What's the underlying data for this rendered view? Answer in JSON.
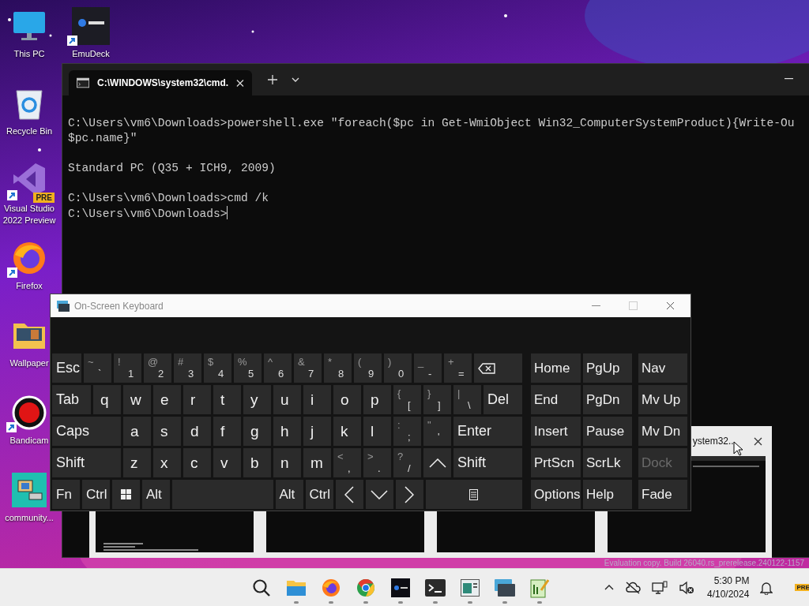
{
  "desktop_icons": [
    {
      "label": "This PC",
      "kind": "computer"
    },
    {
      "label": "EmuDeck",
      "kind": "emudeck",
      "shortcut": true
    },
    {
      "label": "Recycle Bin",
      "kind": "recycle-bin"
    },
    {
      "label": "Visual Studio 2022 Preview",
      "kind": "visual-studio",
      "shortcut": true,
      "badge": "PRE"
    },
    {
      "label": "Firefox",
      "kind": "firefox",
      "shortcut": true
    },
    {
      "label": "Wallpaper",
      "kind": "folder"
    },
    {
      "label": "Bandicam",
      "kind": "bandicam",
      "shortcut": true
    },
    {
      "label": "community...",
      "kind": "network-app"
    }
  ],
  "terminal": {
    "tab_title": "C:\\WINDOWS\\system32\\cmd.",
    "blocks": [
      [
        "C:\\Users\\vm6\\Downloads>powershell.exe \"foreach($pc in Get-WmiObject Win32_ComputerSystemProduct){Write-Ou",
        "$pc.name}\""
      ],
      [
        "Standard PC (Q35 + ICH9, 2009)"
      ],
      [
        "C:\\Users\\vm6\\Downloads>cmd /k",
        "C:\\Users\\vm6\\Downloads>"
      ]
    ]
  },
  "task_switcher": {
    "previews": [
      {
        "kind": "terminal"
      },
      {
        "kind": "blank"
      },
      {
        "kind": "blank"
      },
      {
        "kind": "window",
        "title": "ystem32..."
      }
    ]
  },
  "keyboard": {
    "title": "On-Screen Keyboard",
    "rows": [
      [
        {
          "kind": "function",
          "label": "Esc"
        },
        {
          "kind": "symbol",
          "shift": "~",
          "main": "`"
        },
        {
          "kind": "symbol",
          "shift": "!",
          "main": "1"
        },
        {
          "kind": "symbol",
          "shift": "@",
          "main": "2"
        },
        {
          "kind": "symbol",
          "shift": "#",
          "main": "3"
        },
        {
          "kind": "symbol",
          "shift": "$",
          "main": "4"
        },
        {
          "kind": "symbol",
          "shift": "%",
          "main": "5"
        },
        {
          "kind": "symbol",
          "shift": "^",
          "main": "6"
        },
        {
          "kind": "symbol",
          "shift": "&",
          "main": "7"
        },
        {
          "kind": "symbol",
          "shift": "*",
          "main": "8"
        },
        {
          "kind": "symbol",
          "shift": "(",
          "main": "9"
        },
        {
          "kind": "symbol",
          "shift": ")",
          "main": "0"
        },
        {
          "kind": "symbol",
          "shift": "_",
          "main": "-"
        },
        {
          "kind": "symbol",
          "shift": "+",
          "main": "="
        },
        {
          "kind": "backspace"
        }
      ],
      [
        {
          "kind": "function",
          "label": "Tab"
        },
        {
          "kind": "letter",
          "label": "q"
        },
        {
          "kind": "letter",
          "label": "w"
        },
        {
          "kind": "letter",
          "label": "e"
        },
        {
          "kind": "letter",
          "label": "r"
        },
        {
          "kind": "letter",
          "label": "t"
        },
        {
          "kind": "letter",
          "label": "y"
        },
        {
          "kind": "letter",
          "label": "u"
        },
        {
          "kind": "letter",
          "label": "i"
        },
        {
          "kind": "letter",
          "label": "o"
        },
        {
          "kind": "letter",
          "label": "p"
        },
        {
          "kind": "symbol",
          "shift": "{",
          "main": "["
        },
        {
          "kind": "symbol",
          "shift": "}",
          "main": "]"
        },
        {
          "kind": "symbol",
          "shift": "|",
          "main": "\\"
        },
        {
          "kind": "function",
          "label": "Del"
        }
      ],
      [
        {
          "kind": "function",
          "label": "Caps"
        },
        {
          "kind": "letter",
          "label": "a"
        },
        {
          "kind": "letter",
          "label": "s"
        },
        {
          "kind": "letter",
          "label": "d"
        },
        {
          "kind": "letter",
          "label": "f"
        },
        {
          "kind": "letter",
          "label": "g"
        },
        {
          "kind": "letter",
          "label": "h"
        },
        {
          "kind": "letter",
          "label": "j"
        },
        {
          "kind": "letter",
          "label": "k"
        },
        {
          "kind": "letter",
          "label": "l"
        },
        {
          "kind": "symbol",
          "shift": ":",
          "main": ";"
        },
        {
          "kind": "symbol",
          "shift": "\"",
          "main": "'"
        },
        {
          "kind": "function",
          "label": "Enter"
        }
      ],
      [
        {
          "kind": "function",
          "label": "Shift"
        },
        {
          "kind": "letter",
          "label": "z"
        },
        {
          "kind": "letter",
          "label": "x"
        },
        {
          "kind": "letter",
          "label": "c"
        },
        {
          "kind": "letter",
          "label": "v"
        },
        {
          "kind": "letter",
          "label": "b"
        },
        {
          "kind": "letter",
          "label": "n"
        },
        {
          "kind": "letter",
          "label": "m"
        },
        {
          "kind": "symbol",
          "shift": "<",
          "main": ","
        },
        {
          "kind": "symbol",
          "shift": ">",
          "main": "."
        },
        {
          "kind": "symbol",
          "shift": "?",
          "main": "/"
        },
        {
          "kind": "arrow-up"
        },
        {
          "kind": "function",
          "label": "Shift"
        }
      ],
      [
        {
          "kind": "small",
          "label": "Fn"
        },
        {
          "kind": "small",
          "label": "Ctrl"
        },
        {
          "kind": "windows"
        },
        {
          "kind": "small",
          "label": "Alt"
        },
        {
          "kind": "space"
        },
        {
          "kind": "small",
          "label": "Alt"
        },
        {
          "kind": "small",
          "label": "Ctrl"
        },
        {
          "kind": "arrow-left"
        },
        {
          "kind": "arrow-down"
        },
        {
          "kind": "arrow-right"
        },
        {
          "kind": "menu"
        }
      ]
    ],
    "nav_keys": [
      {
        "label": "Home",
        "disabled": false
      },
      {
        "label": "PgUp",
        "disabled": false
      },
      {
        "label": "Nav",
        "disabled": false
      },
      {
        "label": "End",
        "disabled": false
      },
      {
        "label": "PgDn",
        "disabled": false
      },
      {
        "label": "Mv Up",
        "disabled": false
      },
      {
        "label": "Insert",
        "disabled": false
      },
      {
        "label": "Pause",
        "disabled": false
      },
      {
        "label": "Mv Dn",
        "disabled": false
      },
      {
        "label": "PrtScn",
        "disabled": false
      },
      {
        "label": "ScrLk",
        "disabled": false
      },
      {
        "label": "Dock",
        "disabled": true
      },
      {
        "label": "Options",
        "disabled": false
      },
      {
        "label": "Help",
        "disabled": false
      },
      {
        "label": "Fade",
        "disabled": false
      }
    ]
  },
  "build_notice": "Evaluation copy. Build 26040.rs_prerelease.240122-1157",
  "taskbar": {
    "apps": [
      {
        "kind": "search"
      },
      {
        "kind": "file-explorer",
        "running": true
      },
      {
        "kind": "firefox",
        "running": true
      },
      {
        "kind": "chrome",
        "running": true
      },
      {
        "kind": "emudeck",
        "running": true
      },
      {
        "kind": "terminal",
        "running": true
      },
      {
        "kind": "app-window",
        "running": true
      },
      {
        "kind": "keyboard",
        "running": true
      },
      {
        "kind": "notepad",
        "running": true
      }
    ],
    "time": "5:30 PM",
    "date": "4/10/2024",
    "badge": "PRE"
  }
}
